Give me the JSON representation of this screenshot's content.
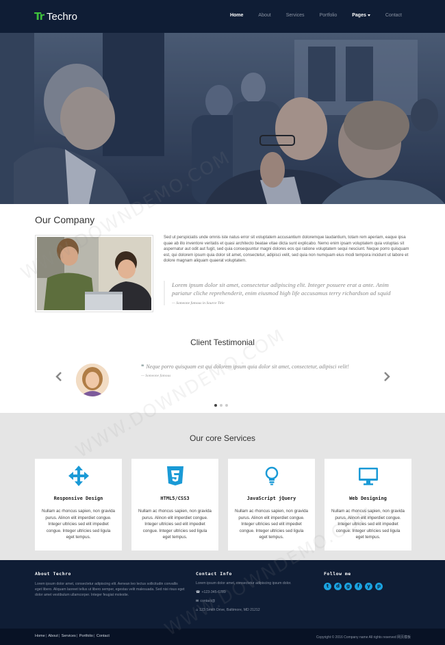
{
  "brand": {
    "mark": "Tr",
    "name": "Techro"
  },
  "nav": {
    "items": [
      "Home",
      "About",
      "Services",
      "Portfolio",
      "Pages",
      "Contact"
    ]
  },
  "company": {
    "title": "Our Company",
    "paragraph": "Sed ut perspiciatis unde omnis iste natus error sit voluptatem accusantium doloremque laudantium, totam rem aperiam, eaque ipsa quae ab illo inventore veritatis et quasi architecto beatae vitae dicta sunt explicabo. Nemo enim ipsam voluptatem quia voluptas sit aspernatur aut odit aut fugit, sed quia consequuntur magni dolores eos qui ratione voluptatem sequi nesciunt. Neque porro quisquam est, qui dolorem ipsum quia dolor sit amet, consectetur, adipisci velit, sed quia non numquam eius modi tempora incidunt ut labore et dolore magnam aliquam quaerat voluptatem.",
    "quote": "Lorem ipsum dolor sit amet, consectetur adipiscing elit. Integer posuere erat a ante. Anim pariatur cliche reprehenderit, enim eiusmod high life accusamus terry richardson ad squid",
    "quote_source": "— Someone famous in Source Title"
  },
  "testimonial": {
    "title": "Client Testimonial",
    "quote_mark": "❝",
    "quote": "Neque porro quisquam est qui dolorem ipsum quia dolor sit amet, consectetur, adipisci velit!",
    "source": "— Someone famous",
    "prev_icon": "‹",
    "next_icon": "›"
  },
  "services": {
    "title": "Our core Services",
    "cards": [
      {
        "icon": "arrows-move-icon",
        "title": "Responsive Design",
        "desc": "Nullam ac rhoncus sapien, non gravida purus. Alinon elit imperdiet congue. Integer ultricies sed elit impediet congue. Integer ultricies sed ligula eget tempus."
      },
      {
        "icon": "css3-icon",
        "title": "HTML5/CSS3",
        "desc": "Nullam ac rhoncus sapien, non gravida purus. Alinon elit imperdiet congue. Integer ultricies sed elit impediet congue. Integer ultricies sed ligula eget tempus."
      },
      {
        "icon": "lightbulb-icon",
        "title": "JavaScript jQuery",
        "desc": "Nullam ac rhoncus sapien, non gravida purus. Alinon elit imperdiet congue. Integer ultricies sed elit impediet congue. Integer ultricies sed ligula eget tempus."
      },
      {
        "icon": "monitor-icon",
        "title": "Web Designing",
        "desc": "Nullam ac rhoncus sapien, non gravida purus. Alinon elit imperdiet congue. Integer ultricies sed elit impediet congue. Integer ultricies sed ligula eget tempus."
      }
    ],
    "accent_color": "#1a9ad6"
  },
  "footer": {
    "about_title": "About Techro",
    "about_text": "Lorem ipsum dolor amet, consectetur adipiscing elit. Aenean leo lectus sollicitudin convallis eget libero. Aliquam laoreet tellus ut libero semper, egestas velit malesuada. Sed nisi risus eget dolor amet vestibulum ullamcorper. Integer feugiat molestie.",
    "contact_title": "Contact Info",
    "contact_text": "Lorem ipsum dolor amet, consectetur adipiscing ipsum dolor.",
    "phone": "+123-345-6789",
    "email": "contact@",
    "address": "123 Smith Drive, Baltimore, MD 21212",
    "follow_title": "Follow me",
    "socials": [
      "twitter-icon",
      "dribbble-icon",
      "github-icon",
      "facebook-icon",
      "youtube-icon",
      "pinterest-icon"
    ],
    "social_glyphs": [
      "t",
      "d",
      "g",
      "f",
      "y",
      "p"
    ]
  },
  "bottom": {
    "links": [
      "Home",
      "About",
      "Services",
      "Portfolio",
      "Contact"
    ],
    "copyright": "Copyright © 2016 Company name All rights reserved 网页模板"
  },
  "watermark": "WWW.DOWNDEMO.COM"
}
